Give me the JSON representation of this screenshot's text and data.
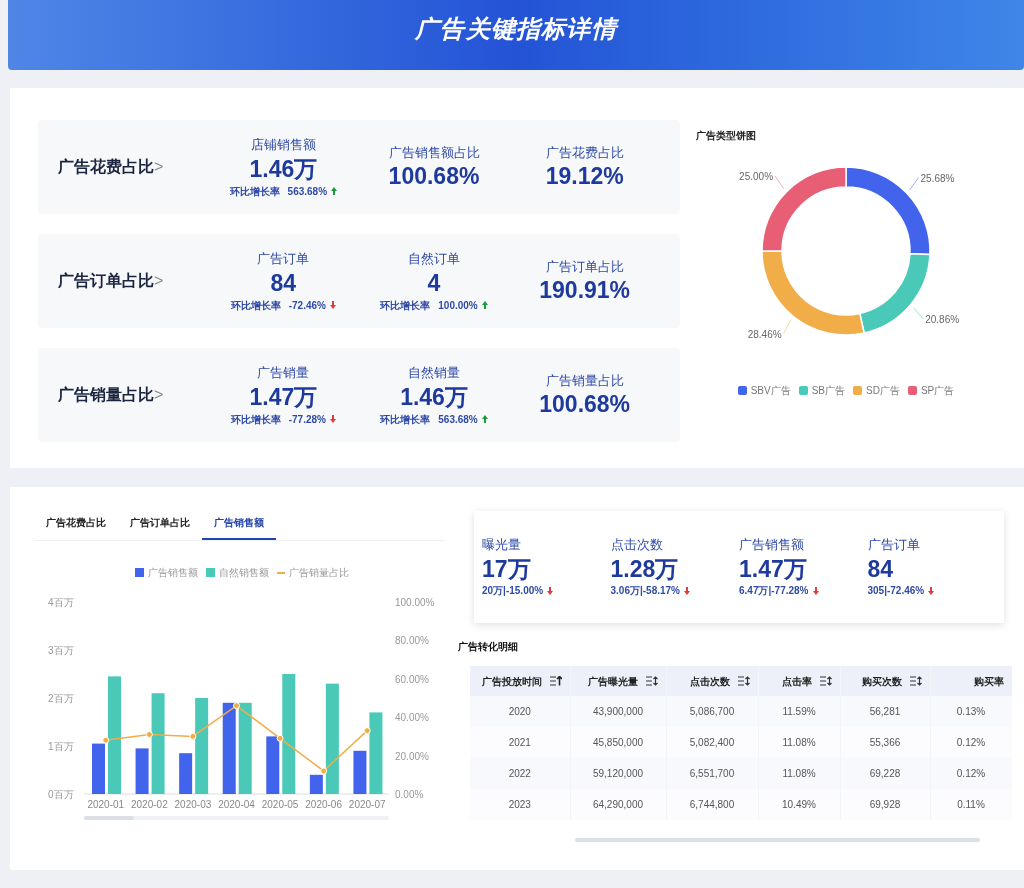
{
  "header": {
    "title": "广告关键指标详情"
  },
  "stat_rows": [
    {
      "title": "广告花费占比",
      "chevron": ">",
      "metrics": [
        {
          "label": "店铺销售额",
          "value": "1.46万",
          "growth": {
            "label": "环比增长率",
            "value": "563.68%",
            "rising": true
          }
        },
        {
          "label": "广告销售额占比",
          "value": "100.68%"
        },
        {
          "label": "广告花费占比",
          "value": "19.12%"
        }
      ]
    },
    {
      "title": "广告订单占比",
      "chevron": ">",
      "metrics": [
        {
          "label": "广告订单",
          "value": "84",
          "growth": {
            "label": "环比增长率",
            "value": "-72.46%",
            "rising": false
          }
        },
        {
          "label": "自然订单",
          "value": "4",
          "growth": {
            "label": "环比增长率",
            "value": "100.00%",
            "rising": true
          }
        },
        {
          "label": "广告订单占比",
          "value": "190.91%"
        }
      ]
    },
    {
      "title": "广告销量占比",
      "chevron": ">",
      "metrics": [
        {
          "label": "广告销量",
          "value": "1.47万",
          "growth": {
            "label": "环比增长率",
            "value": "-77.28%",
            "rising": false
          }
        },
        {
          "label": "自然销量",
          "value": "1.46万",
          "growth": {
            "label": "环比增长率",
            "value": "563.68%",
            "rising": true
          }
        },
        {
          "label": "广告销量占比",
          "value": "100.68%"
        }
      ]
    }
  ],
  "pie_panel": {
    "title": "广告类型饼图",
    "chart_data": {
      "type": "donut",
      "categories": [
        "SBV广告",
        "SB广告",
        "SD广告",
        "SP广告"
      ],
      "values": [
        25.68,
        20.86,
        28.46,
        25.0
      ],
      "value_labels": [
        "25.68%",
        "20.86%",
        "28.46%",
        "25.00%"
      ],
      "colors": [
        "#4263eb",
        "#4ac9b9",
        "#f0ad48",
        "#e85f75"
      ]
    }
  },
  "chart_tabs": [
    {
      "label": "广告花费占比",
      "selected": false
    },
    {
      "label": "广告订单占比",
      "selected": false
    },
    {
      "label": "广告销售额",
      "selected": true
    }
  ],
  "sales_chart": {
    "chart_data": {
      "type": "bar",
      "categories": [
        "2020-01",
        "2020-02",
        "2020-03",
        "2020-04",
        "2020-05",
        "2020-06",
        "2020-07"
      ],
      "series": [
        {
          "name": "广告销售额",
          "color": "#4263eb",
          "values": [
            1.05,
            0.95,
            0.85,
            1.9,
            1.2,
            0.4,
            0.9
          ]
        },
        {
          "name": "自然销售额",
          "color": "#4ac9b9",
          "values": [
            2.45,
            2.1,
            2.0,
            1.9,
            2.5,
            2.3,
            1.7
          ]
        },
        {
          "name": "广告销量占比",
          "type": "line",
          "axis": "y2",
          "marker": "o",
          "color": "#f0ad48",
          "values": [
            28,
            31,
            30,
            46,
            29,
            12,
            33
          ]
        }
      ],
      "legend": "top",
      "ylim": [
        0,
        4
      ],
      "y2lim": [
        0,
        100
      ],
      "yticks": [
        {
          "value": 0,
          "label": "0百万"
        },
        {
          "value": 1,
          "label": "1百万"
        },
        {
          "value": 2,
          "label": "2百万"
        },
        {
          "value": 3,
          "label": "3百万"
        },
        {
          "value": 4,
          "label": "4百万"
        }
      ],
      "y2ticks": [
        {
          "value": 0,
          "label": "0.00%"
        },
        {
          "value": 20,
          "label": "20.00%"
        },
        {
          "value": 40,
          "label": "40.00%"
        },
        {
          "value": 60,
          "label": "60.00%"
        },
        {
          "value": 80,
          "label": "80.00%"
        },
        {
          "value": 100,
          "label": "100.00%"
        }
      ]
    }
  },
  "kpis": [
    {
      "label": "曝光量",
      "value": "17万",
      "compare": "20万|-15.00%",
      "rising": false
    },
    {
      "label": "点击次数",
      "value": "1.28万",
      "compare": "3.06万|-58.17%",
      "rising": false
    },
    {
      "label": "广告销售额",
      "value": "1.47万",
      "compare": "6.47万|-77.28%",
      "rising": false
    },
    {
      "label": "广告订单",
      "value": "84",
      "compare": "305|-72.46%",
      "rising": false
    }
  ],
  "table": {
    "title": "广告转化明细",
    "columns": [
      {
        "label": "广告投放时间",
        "sorted_ascending": true
      },
      {
        "label": "广告曝光量",
        "sorted_ascending": false
      },
      {
        "label": "点击次数",
        "sorted_ascending": false
      },
      {
        "label": "点击率",
        "sorted_ascending": false
      },
      {
        "label": "购买次数",
        "sorted_ascending": false
      },
      {
        "label": "购买率"
      }
    ],
    "rows": [
      [
        "2020",
        "43,900,000",
        "5,086,700",
        "11.59%",
        "56,281",
        "0.13%"
      ],
      [
        "2021",
        "45,850,000",
        "5,082,400",
        "11.08%",
        "55,366",
        "0.12%"
      ],
      [
        "2022",
        "59,120,000",
        "6,551,700",
        "11.08%",
        "69,228",
        "0.12%"
      ],
      [
        "2023",
        "64,290,000",
        "6,744,800",
        "10.49%",
        "69,928",
        "0.11%"
      ]
    ]
  }
}
